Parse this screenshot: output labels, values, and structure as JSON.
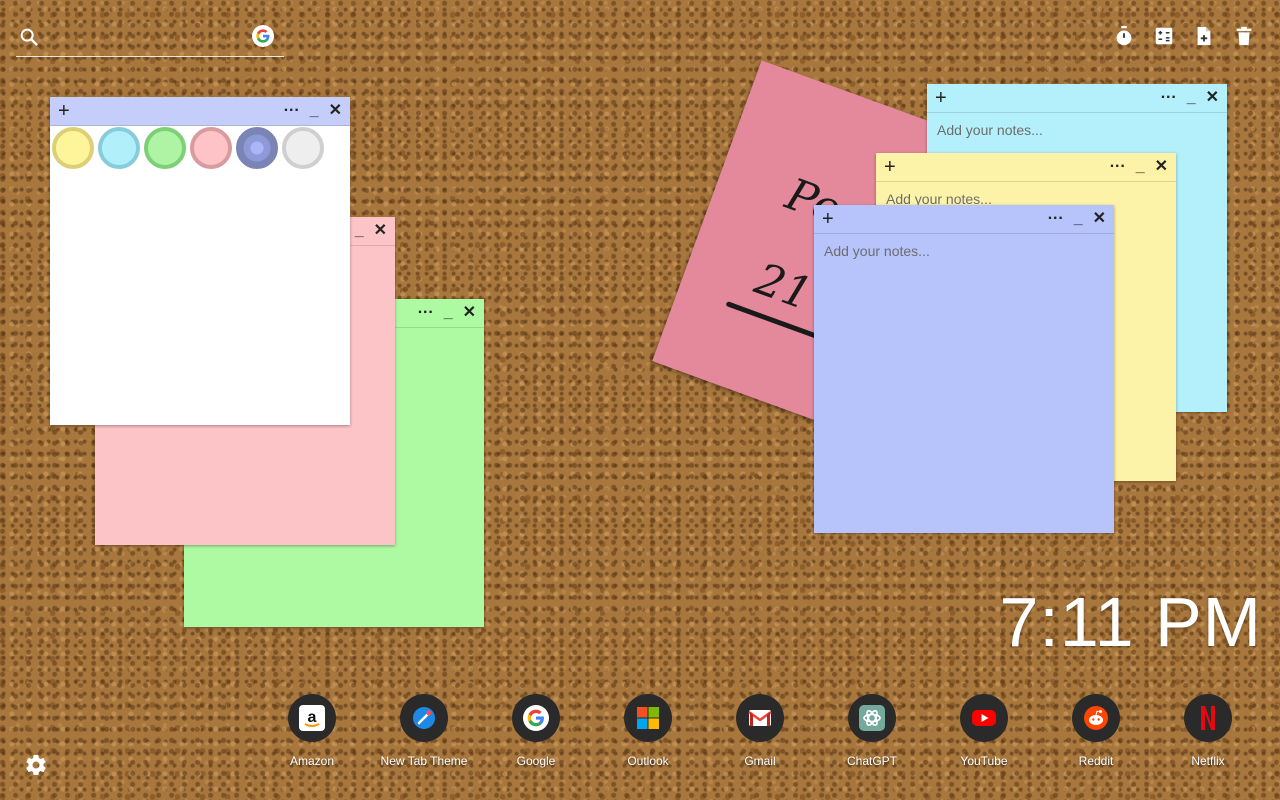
{
  "search": {
    "placeholder": "",
    "value": ""
  },
  "icons": {
    "search": "search-icon",
    "google": "google-icon",
    "timer": "timer-icon",
    "calculator": "calculator-icon",
    "new_note": "add-note-icon",
    "trash": "trash-icon",
    "settings": "settings-icon"
  },
  "notes": [
    {
      "id": "cyan",
      "color": "#b4f0fb",
      "placeholder": "Add your notes..."
    },
    {
      "id": "yellow",
      "color": "#fdf3a8",
      "placeholder": "Add your notes..."
    },
    {
      "id": "blue",
      "color": "#b7c4fc",
      "placeholder": "Add your notes..."
    },
    {
      "id": "green",
      "color": "#aefaa2"
    },
    {
      "id": "pink",
      "color": "#fdc4c7"
    },
    {
      "id": "white",
      "color": "#ffffff",
      "bar_color": "#c5cdfb"
    }
  ],
  "note_controls": {
    "plus": "+",
    "more": "···",
    "minimize": "_",
    "close": "✕"
  },
  "palette": [
    {
      "fill": "#fef59a",
      "ring": "#dccf76"
    },
    {
      "fill": "#b1f0fb",
      "ring": "#86cddb"
    },
    {
      "fill": "#aef4a4",
      "ring": "#7ed077"
    },
    {
      "fill": "#fdc3c7",
      "ring": "#d99ba0"
    },
    {
      "fill": "#b8c3fb",
      "ring": "#7b85b5"
    },
    {
      "fill": "#eeeeee",
      "ring": "#cfcfcf"
    }
  ],
  "paper_note": {
    "line1": "Poe",
    "line2": "21"
  },
  "clock": {
    "time": "7:11 PM"
  },
  "shortcuts": [
    {
      "label": "Amazon"
    },
    {
      "label": "New Tab Theme"
    },
    {
      "label": "Google"
    },
    {
      "label": "Outlook"
    },
    {
      "label": "Gmail"
    },
    {
      "label": "ChatGPT"
    },
    {
      "label": "YouTube"
    },
    {
      "label": "Reddit"
    },
    {
      "label": "Netflix"
    }
  ]
}
